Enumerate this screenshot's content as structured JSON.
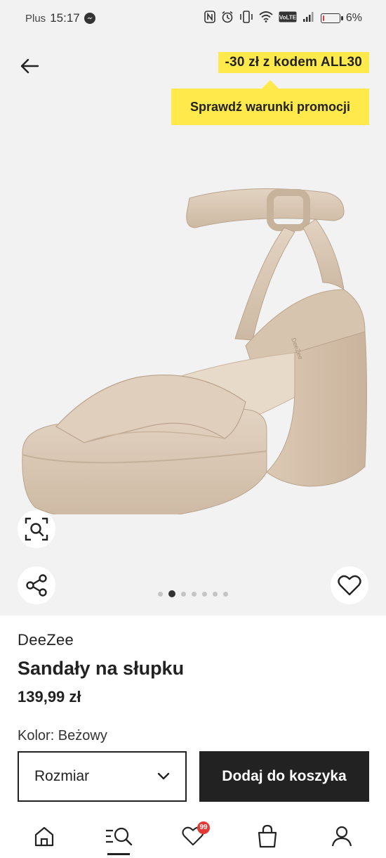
{
  "status_bar": {
    "carrier": "Plus",
    "time": "15:17",
    "battery_percent": "6%",
    "volte_label": "VoLTE",
    "battery_level": 0.06,
    "icons": [
      "messenger-icon",
      "nfc-icon",
      "alarm-icon",
      "vibrate-icon",
      "wifi-icon",
      "volte-icon",
      "signal-icon",
      "battery-icon"
    ]
  },
  "promo": {
    "code_text": "-30 zł z kodem ALL30",
    "terms_text": "Sprawdź warunki promocji",
    "color": "#ffe94b"
  },
  "gallery": {
    "image_count": 7,
    "active_index": 1,
    "image_label": "DeeZee"
  },
  "product": {
    "brand": "DeeZee",
    "name": "Sandały na słupku",
    "price": "139,99 zł",
    "color_label": "Kolor: Beżowy"
  },
  "actions": {
    "size_label": "Rozmiar",
    "add_to_cart_label": "Dodaj do koszyka"
  },
  "bottom_nav": {
    "items": [
      "home-icon",
      "search-icon",
      "heart-icon",
      "bag-icon",
      "profile-icon"
    ],
    "active": "search-icon",
    "wishlist_badge": "99"
  },
  "colors": {
    "accent": "#222222",
    "badge": "#e53935",
    "background": "#f2f2f2"
  }
}
